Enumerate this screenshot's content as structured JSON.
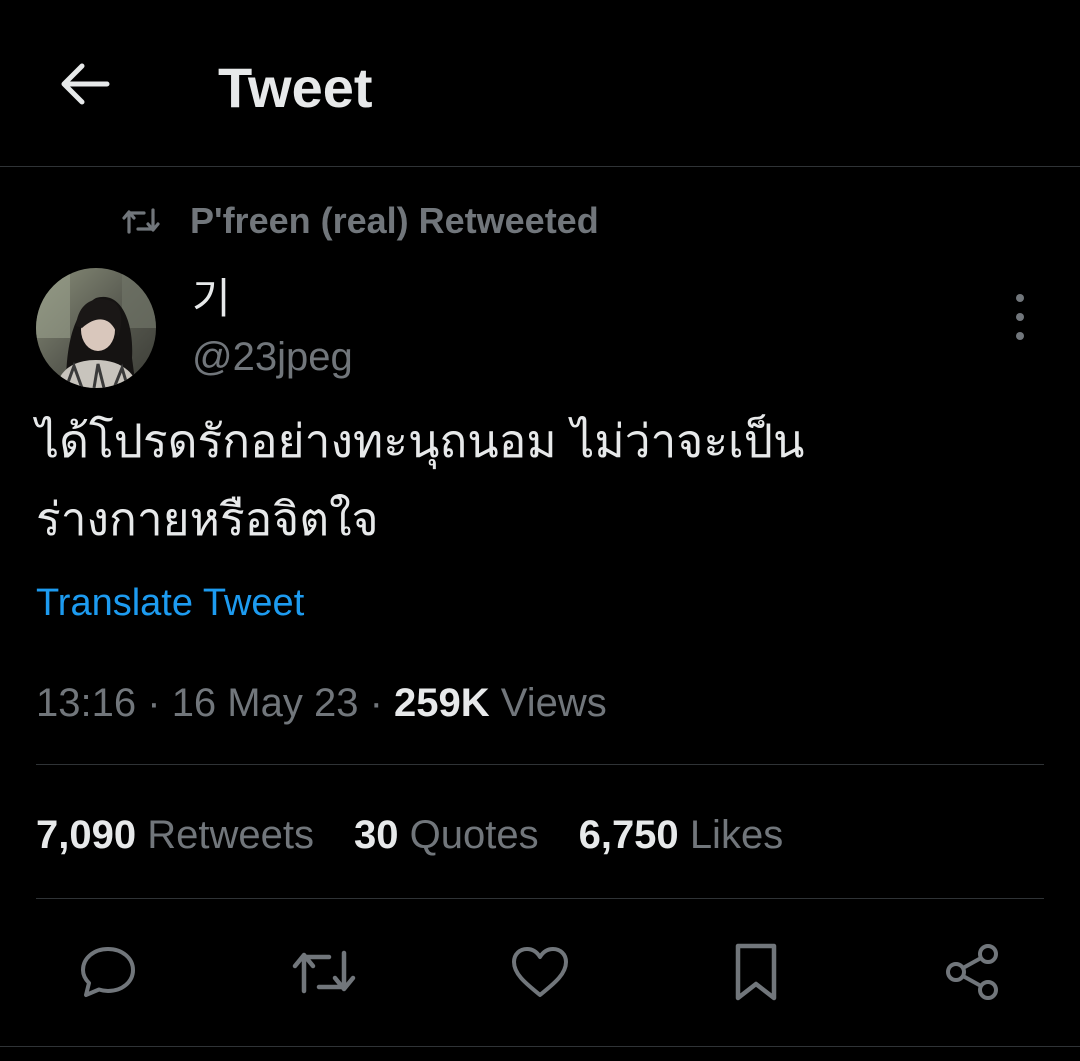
{
  "header": {
    "title": "Tweet",
    "back_icon": "arrow-left-icon"
  },
  "retweet_context": {
    "icon": "retweet-icon",
    "text": "P'freen (real) Retweeted"
  },
  "author": {
    "display_name": "기",
    "handle": "@23jpeg"
  },
  "tweet": {
    "lines": [
      "ได้โปรดรักอย่างทะนุถนอม ไม่ว่าจะเป็น",
      "ร่างกายหรือจิตใจ"
    ],
    "translate_label": "Translate Tweet"
  },
  "meta": {
    "time": "13:16",
    "separator": "·",
    "date": "16 May 23",
    "views_count": "259K",
    "views_label": "Views"
  },
  "stats": {
    "retweets_count": "7,090",
    "retweets_label": "Retweets",
    "quotes_count": "30",
    "quotes_label": "Quotes",
    "likes_count": "6,750",
    "likes_label": "Likes"
  },
  "actions": {
    "icons": [
      "reply-icon",
      "retweet-icon",
      "like-icon",
      "bookmark-icon",
      "share-icon"
    ]
  },
  "colors": {
    "background": "#000000",
    "text_primary": "#e7e9ea",
    "text_secondary": "#71767b",
    "link": "#1d9bf0",
    "divider": "#2f3336"
  }
}
